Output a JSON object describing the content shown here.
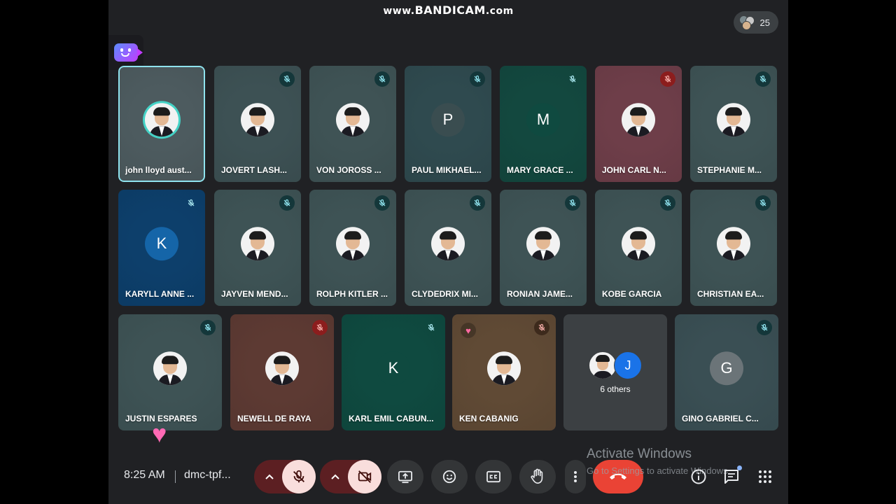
{
  "watermark": {
    "prefix": "www.",
    "brand": "BANDICAM",
    "suffix": ".com"
  },
  "participants_count": "25",
  "tiles": [
    {
      "name": "john lloyd aust...",
      "avatar": "photo",
      "bg": "#4d5b5f",
      "active": true,
      "mic": "none"
    },
    {
      "name": "JOVERT LASH...",
      "avatar": "photo",
      "bg": "#3d5154",
      "mic": "muted"
    },
    {
      "name": "VON JOROSS ...",
      "avatar": "photo",
      "bg": "#3f5355",
      "mic": "muted"
    },
    {
      "name": "PAUL MIKHAEL...",
      "avatar": "letter",
      "letter": "P",
      "letter_bg": "#3a4d50",
      "bg": "#2f4a4f",
      "mic": "muted"
    },
    {
      "name": "MARY GRACE ...",
      "avatar": "letter",
      "letter": "M",
      "letter_bg": "#0f4a40",
      "bg": "#13483f",
      "mic": "muted-plain"
    },
    {
      "name": "JOHN CARL N...",
      "avatar": "photo",
      "bg": "#6e3e49",
      "mic": "muted-red"
    },
    {
      "name": "STEPHANIE M...",
      "avatar": "photo",
      "bg": "#3e5355",
      "mic": "muted"
    },
    {
      "name": "KARYLL ANNE ...",
      "avatar": "letter",
      "letter": "K",
      "letter_bg": "#1565a8",
      "bg": "#0d3f6b",
      "mic": "muted-plain"
    },
    {
      "name": "JAYVEN MEND...",
      "avatar": "photo",
      "bg": "#3e5355",
      "mic": "muted"
    },
    {
      "name": "ROLPH KITLER ...",
      "avatar": "photo",
      "bg": "#3e5355",
      "mic": "muted"
    },
    {
      "name": "CLYDEDRIX MI...",
      "avatar": "photo",
      "bg": "#3e5355",
      "mic": "muted"
    },
    {
      "name": "RONIAN JAME...",
      "avatar": "photo",
      "bg": "#3e5355",
      "mic": "muted"
    },
    {
      "name": "KOBE GARCIA",
      "avatar": "photo",
      "bg": "#3e5355",
      "mic": "muted"
    },
    {
      "name": "CHRISTIAN EA...",
      "avatar": "photo",
      "bg": "#3e5355",
      "mic": "muted"
    },
    {
      "name": "JUSTIN ESPARES",
      "avatar": "photo",
      "bg": "#3e5355",
      "mic": "muted"
    },
    {
      "name": "NEWELL DE RAYA",
      "avatar": "photo",
      "bg": "#5d3a33",
      "mic": "muted-red"
    },
    {
      "name": "KARL EMIL CABUN...",
      "avatar": "letter",
      "letter": "K",
      "letter_bg": "#0f4a40",
      "bg": "#0f4a40",
      "mic": "muted-plain"
    },
    {
      "name": "KEN CABANIG",
      "avatar": "photo",
      "bg": "#604a35",
      "mic": "muted-brown",
      "reaction": "heart"
    },
    {
      "name": "",
      "avatar": "others",
      "bg": "#3c4043",
      "mic": "none",
      "others_label": "6 others",
      "others_letter": "J"
    },
    {
      "name": "GINO GABRIEL C...",
      "avatar": "letter",
      "letter": "G",
      "letter_bg": "#6b7478",
      "bg": "#3a4f54",
      "mic": "muted"
    }
  ],
  "bottom": {
    "time": "8:25 AM",
    "meeting_code": "dmc-tpf..."
  },
  "controls": {
    "mic": {
      "state": "muted"
    },
    "camera": {
      "state": "off"
    },
    "present": {
      "icon": "present-screen-icon"
    },
    "emoji": {
      "icon": "emoji-icon"
    },
    "captions": {
      "icon": "captions-icon"
    },
    "hand": {
      "icon": "raise-hand-icon"
    },
    "more": {
      "icon": "more-vert-icon"
    },
    "end_call": {
      "icon": "end-call-icon"
    }
  },
  "activate_windows": {
    "title": "Activate Windows",
    "subtitle": "Go to Settings to activate Windows."
  },
  "colors": {
    "background": "#202124",
    "end_call": "#ea4335",
    "muted_pill": "#f9dedc",
    "muted_pill_dark": "#5c1f22",
    "active_border": "#8fe3ee"
  }
}
